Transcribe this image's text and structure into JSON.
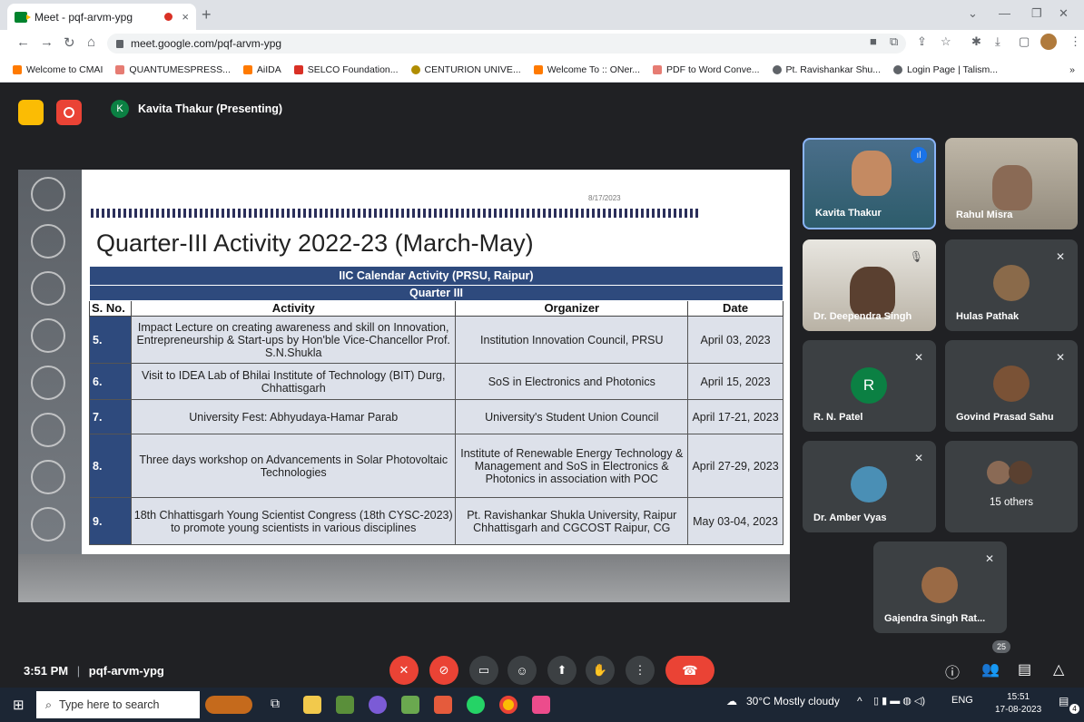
{
  "browser": {
    "tab_title": "Meet - pqf-arvm-ypg",
    "tab_close": "×",
    "new_tab": "+",
    "url": "meet.google.com/pqf-arvm-ypg",
    "bookmarks": [
      "Welcome to CMAI",
      "QUANTUMESPRESS...",
      "AiIDA",
      "SELCO Foundation...",
      "CENTURION UNIVE...",
      "Welcome To :: ONer...",
      "PDF to Word Conve...",
      "Pt. Ravishankar Shu...",
      "Login Page | Talism..."
    ],
    "bookmarks_more": "»"
  },
  "meet": {
    "presenter_initial": "K",
    "presenter_label": "Kavita Thakur (Presenting)",
    "time": "3:51 PM",
    "separator": "|",
    "meeting_code": "pqf-arvm-ypg",
    "participant_count": "25"
  },
  "slide": {
    "date": "8/17/2023",
    "title": "Quarter-III Activity 2022-23 (March-May)",
    "header1": "IIC Calendar Activity (PRSU, Raipur)",
    "header2": "Quarter III",
    "col_sno": "S. No.",
    "col_activity": "Activity",
    "col_organizer": "Organizer",
    "col_date": "Date",
    "rows": [
      {
        "sno": "5.",
        "activity": "Impact Lecture on creating awareness and skill on Innovation, Entrepreneurship & Start-ups by Hon'ble Vice-Chancellor Prof. S.N.Shukla",
        "organizer": "Institution Innovation Council, PRSU",
        "date": "April 03, 2023"
      },
      {
        "sno": "6.",
        "activity": "Visit to IDEA Lab of Bhilai Institute of Technology (BIT) Durg, Chhattisgarh",
        "organizer": "SoS in Electronics and Photonics",
        "date": "April 15, 2023"
      },
      {
        "sno": "7.",
        "activity": "University Fest: Abhyudaya-Hamar Parab",
        "organizer": "University's Student Union Council",
        "date": "April 17-21, 2023"
      },
      {
        "sno": "8.",
        "activity": "Three days workshop on Advancements in Solar Photovoltaic Technologies",
        "organizer": "Institute of Renewable Energy Technology & Management and SoS in Electronics & Photonics in association with POC",
        "date": "April 27-29, 2023"
      },
      {
        "sno": "9.",
        "activity": "18th Chhattisgarh Young Scientist Congress (18th CYSC-2023) to promote young scientists in various disciplines",
        "organizer": "Pt. Ravishankar Shukla University, Raipur Chhattisgarh and CGCOST Raipur, CG",
        "date": "May 03-04, 2023"
      }
    ]
  },
  "participants": [
    {
      "name": "Kavita Thakur"
    },
    {
      "name": "Rahul Misra"
    },
    {
      "name": "Dr. Deependra Singh"
    },
    {
      "name": "Hulas Pathak"
    },
    {
      "name": "R. N. Patel",
      "initial": "R"
    },
    {
      "name": "Govind Prasad Sahu"
    },
    {
      "name": "Dr. Amber Vyas"
    },
    {
      "name": "15 others"
    },
    {
      "name": "Gajendra Singh Rat..."
    }
  ],
  "taskbar": {
    "search_placeholder": "Type here to search",
    "weather": "30°C  Mostly cloudy",
    "lang": "ENG",
    "time": "15:51",
    "date": "17-08-2023",
    "notif": "4"
  },
  "colors": {
    "accent_red": "#ea4335",
    "slide_blue": "#2e4a7d",
    "meet_bg": "#202124"
  }
}
